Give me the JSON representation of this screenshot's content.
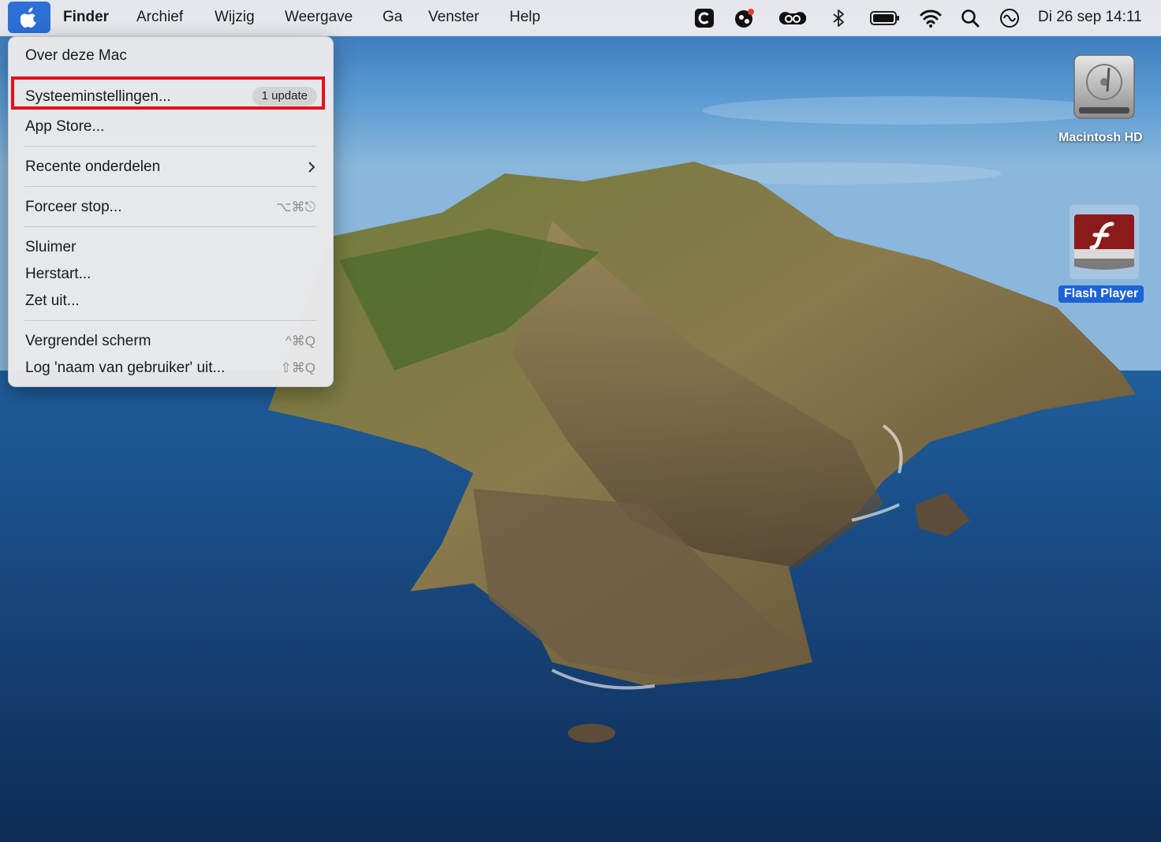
{
  "menubar": {
    "items": [
      "Finder",
      "Archief",
      "Wijzig",
      "Weergave",
      "Ga",
      "Venster",
      "Help"
    ],
    "status_icons": [
      "c-app-icon",
      "app-notification-icon",
      "creative-cloud-icon",
      "bluetooth-icon",
      "battery-icon",
      "wifi-icon",
      "search-icon",
      "siri-icon"
    ],
    "clock": "Di 26 sep 14:11"
  },
  "apple_menu": {
    "about": "Over deze Mac",
    "settings": "Systeeminstellingen...",
    "settings_badge": "1 update",
    "app_store": "App Store...",
    "recent": "Recente onderdelen",
    "force_quit": "Forceer stop...",
    "force_quit_shortcut": "⌥⌘⎋",
    "sleep": "Sluimer",
    "restart": "Herstart...",
    "shutdown": "Zet uit...",
    "lock": "Vergrendel scherm",
    "lock_shortcut": "^⌘Q",
    "logout": "Log 'naam van gebruiker' uit...",
    "logout_shortcut": "⇧⌘Q"
  },
  "desktop": {
    "icons": [
      {
        "label": "Macintosh HD",
        "icon": "hard-drive-icon",
        "selected": false
      },
      {
        "label": "Flash Player",
        "icon": "flash-player-icon",
        "selected": true
      }
    ]
  },
  "colors": {
    "accent": "#2e6fd6",
    "highlight_box": "#e3101b",
    "selection": "#1c63d8"
  }
}
